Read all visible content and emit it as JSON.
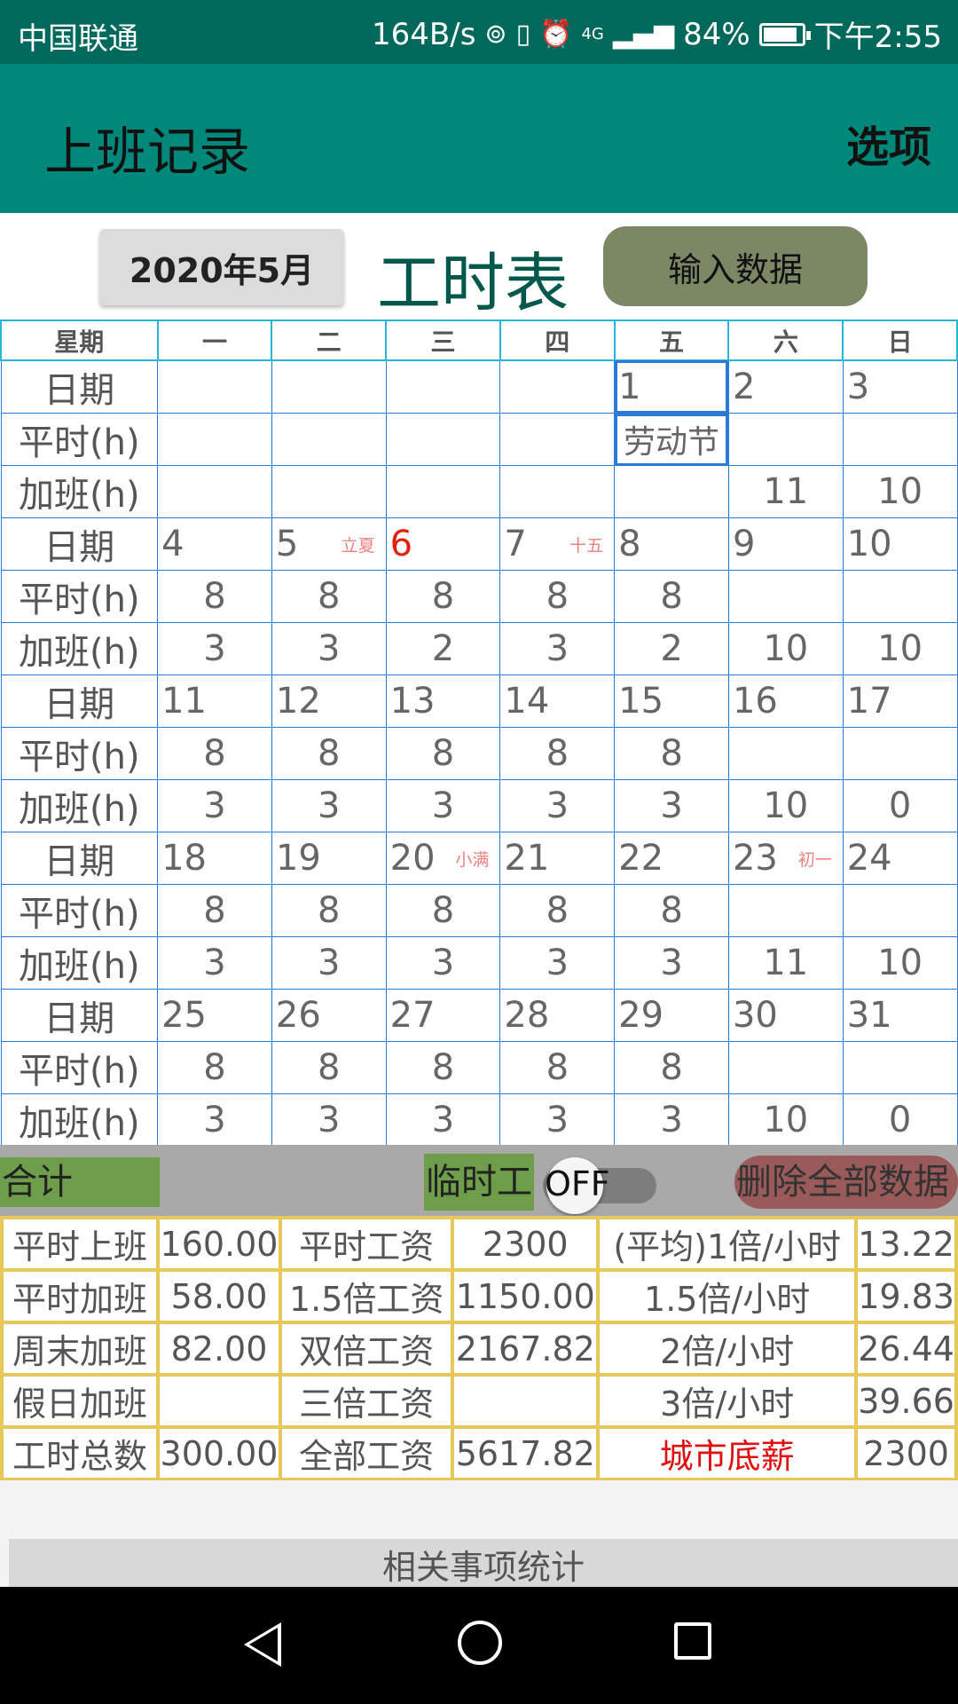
{
  "status_bar": {
    "carrier": "中国联通",
    "speed": "164B/s",
    "hotspot_icon": "hotspot-icon",
    "vibrate_icon": "vibrate-icon",
    "alarm_icon": "alarm-icon",
    "network": "4G",
    "signal_icon": "signal-icon",
    "battery_percent": "84%",
    "battery_level": 0.84,
    "time": "下午2:55"
  },
  "toolbar": {
    "title": "上班记录",
    "options_label": "选项"
  },
  "header": {
    "month_label": "2020年5月",
    "sheet_title": "工时表",
    "input_button_label": "输入数据"
  },
  "calendar": {
    "weekday_header": [
      "星期",
      "一",
      "二",
      "三",
      "四",
      "五",
      "六",
      "日"
    ],
    "row_labels": {
      "date": "日期",
      "regular": "平时(h)",
      "overtime": "加班(h)"
    },
    "weeks": [
      {
        "dates": [
          "",
          "",
          "",
          "",
          "1",
          "2",
          "3"
        ],
        "festivals": [
          "",
          "",
          "",
          "",
          "",
          "",
          ""
        ],
        "regular": [
          "",
          "",
          "",
          "",
          "劳动节",
          "",
          ""
        ],
        "overtime": [
          "",
          "",
          "",
          "",
          "",
          "11",
          "10"
        ]
      },
      {
        "dates": [
          "4",
          "5",
          "6",
          "7",
          "8",
          "9",
          "10"
        ],
        "festivals": [
          "",
          "立夏",
          "",
          "十五",
          "",
          "",
          ""
        ],
        "regular": [
          "8",
          "8",
          "8",
          "8",
          "8",
          "",
          ""
        ],
        "overtime": [
          "3",
          "3",
          "2",
          "3",
          "2",
          "10",
          "10"
        ]
      },
      {
        "dates": [
          "11",
          "12",
          "13",
          "14",
          "15",
          "16",
          "17"
        ],
        "festivals": [
          "",
          "",
          "",
          "",
          "",
          "",
          ""
        ],
        "regular": [
          "8",
          "8",
          "8",
          "8",
          "8",
          "",
          ""
        ],
        "overtime": [
          "3",
          "3",
          "3",
          "3",
          "3",
          "10",
          "0"
        ]
      },
      {
        "dates": [
          "18",
          "19",
          "20",
          "21",
          "22",
          "23",
          "24"
        ],
        "festivals": [
          "",
          "",
          "小满",
          "",
          "",
          "初一",
          ""
        ],
        "regular": [
          "8",
          "8",
          "8",
          "8",
          "8",
          "",
          ""
        ],
        "overtime": [
          "3",
          "3",
          "3",
          "3",
          "3",
          "11",
          "10"
        ]
      },
      {
        "dates": [
          "25",
          "26",
          "27",
          "28",
          "29",
          "30",
          "31"
        ],
        "festivals": [
          "",
          "",
          "",
          "",
          "",
          "",
          ""
        ],
        "regular": [
          "8",
          "8",
          "8",
          "8",
          "8",
          "",
          ""
        ],
        "overtime": [
          "3",
          "3",
          "3",
          "3",
          "3",
          "10",
          "0"
        ]
      }
    ],
    "highlight_red_date": "6",
    "holiday_cell_label": "劳动节"
  },
  "summary_bar": {
    "total_label": "合计",
    "temp_worker_label": "临时工",
    "switch_state": "OFF",
    "delete_all_label": "删除全部数据"
  },
  "stats": {
    "rows": [
      [
        "平时上班",
        "160.00",
        "平时工资",
        "2300",
        "(平均)1倍/小时",
        "13.22"
      ],
      [
        "平时加班",
        "58.00",
        "1.5倍工资",
        "1150.00",
        "1.5倍/小时",
        "19.83"
      ],
      [
        "周末加班",
        "82.00",
        "双倍工资",
        "2167.82",
        "2倍/小时",
        "26.44"
      ],
      [
        "假日加班",
        "",
        "三倍工资",
        "",
        "3倍/小时",
        "39.66"
      ],
      [
        "工时总数",
        "300.00",
        "全部工资",
        "5617.82",
        "城市底薪",
        "2300"
      ]
    ],
    "red_cell": "城市底薪"
  },
  "related": {
    "label": "相关事项统计"
  },
  "colors": {
    "status_bar": "#00695c",
    "toolbar": "#00897b",
    "calendar_border": "#2a7bd3",
    "header_border": "#27b6d8",
    "green_label": "#6f9e4a",
    "delete_button": "#9b5a5a",
    "stats_border": "#e8c85a",
    "red_text": "#e01010",
    "festival_text": "#f08080"
  }
}
